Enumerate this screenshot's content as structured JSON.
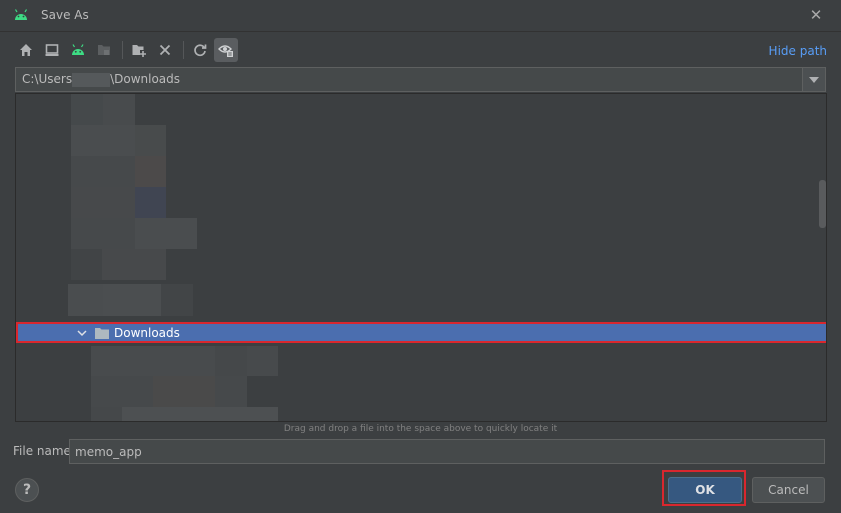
{
  "window": {
    "title": "Save As",
    "close_symbol": "✕",
    "app_icon": "android-icon"
  },
  "toolbar": {
    "buttons": [
      {
        "icon": "home-icon"
      },
      {
        "icon": "desktop-icon"
      },
      {
        "icon": "android-project-icon"
      },
      {
        "icon": "module-folder-icon"
      },
      {
        "icon": "new-folder-icon"
      },
      {
        "icon": "delete-icon"
      },
      {
        "icon": "refresh-icon"
      },
      {
        "icon": "show-hidden-files-icon"
      }
    ],
    "hide_path_label": "Hide path"
  },
  "path": {
    "prefix": "C:\\Users",
    "suffix": "\\Downloads"
  },
  "tree": {
    "selected_item": "Downloads"
  },
  "hint": "Drag and drop a file into the space above to quickly locate it",
  "file_name": {
    "label": "File name:",
    "value": "memo_app"
  },
  "buttons": {
    "help": "?",
    "ok": "OK",
    "cancel": "Cancel"
  },
  "colors": {
    "accent_link": "#589df6",
    "selection": "#4b6eaf",
    "highlight_box": "#d9272e",
    "ok_button": "#365880",
    "android_green": "#3ddc84"
  }
}
